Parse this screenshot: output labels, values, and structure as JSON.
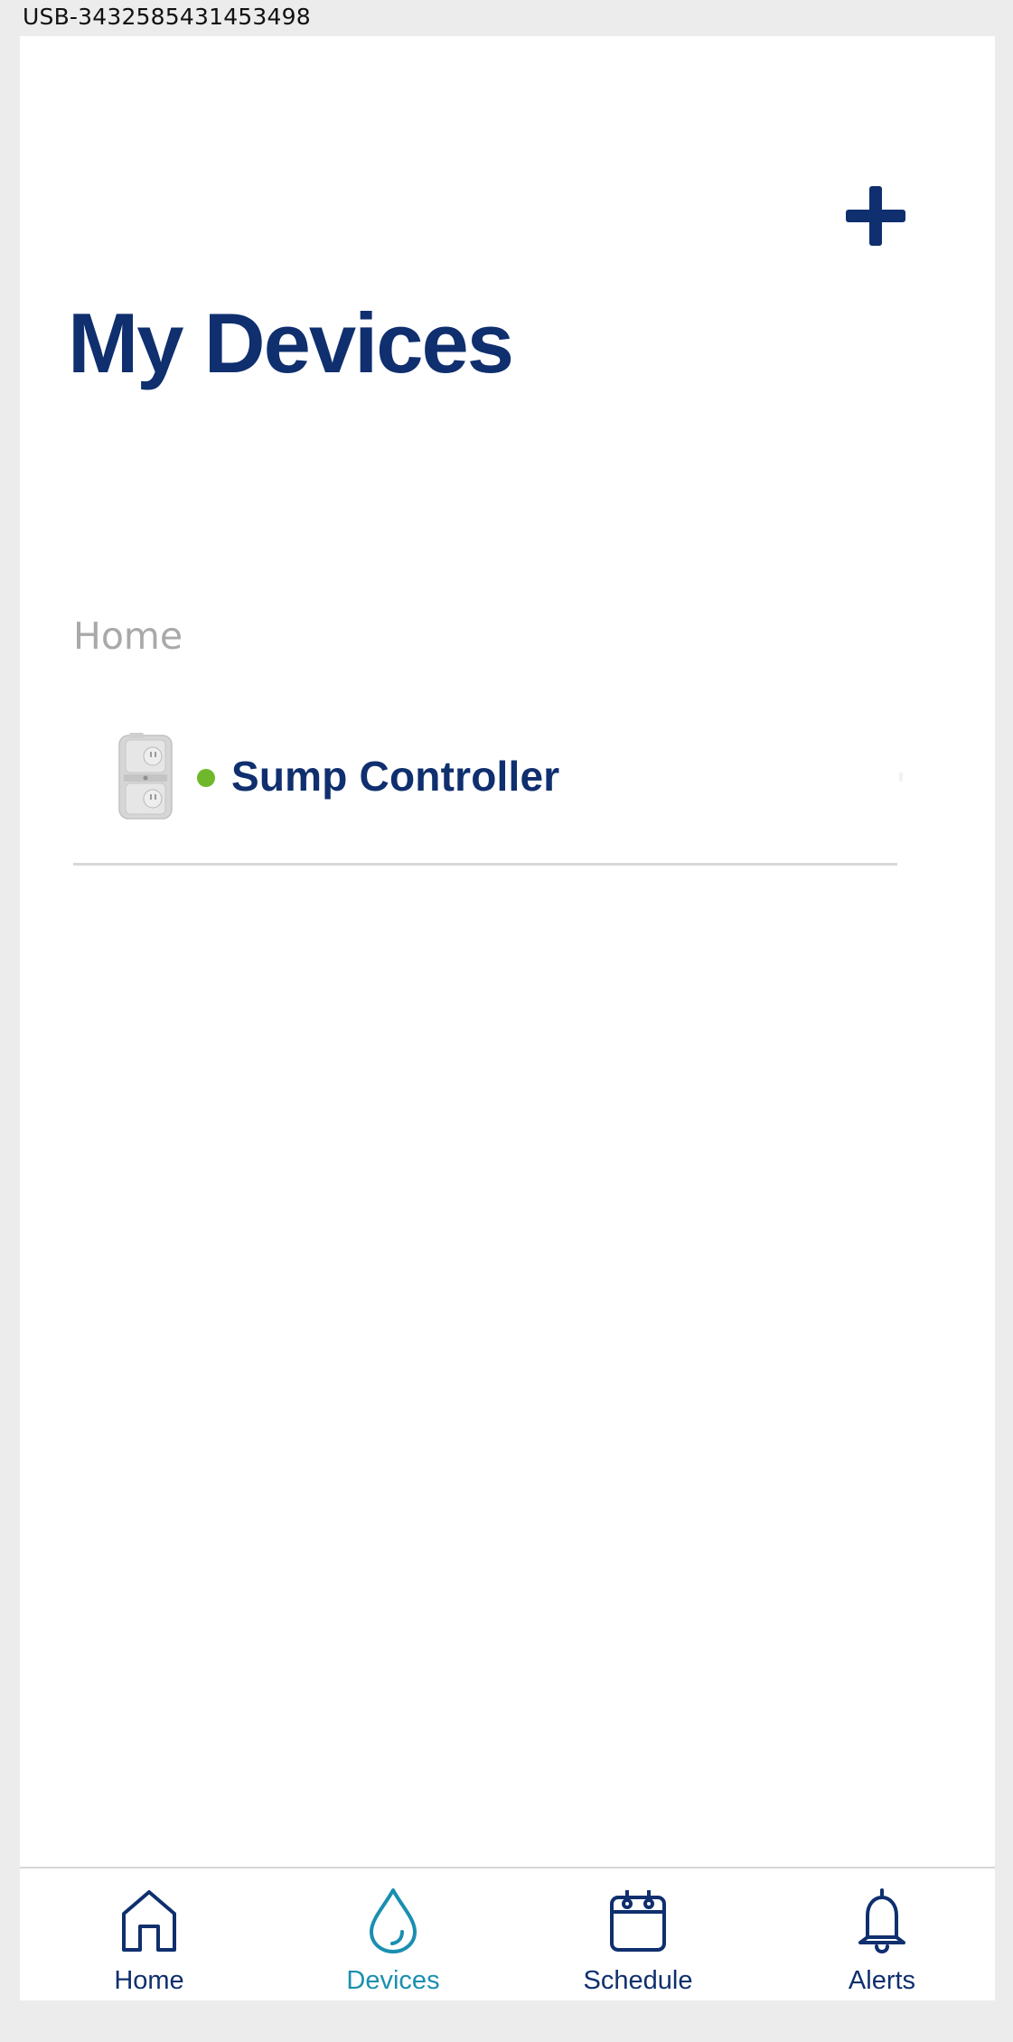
{
  "device_id": "USB-3432585431453498",
  "header": {
    "title": "My Devices",
    "add_icon": "plus-icon"
  },
  "section": {
    "label": "Home"
  },
  "devices": [
    {
      "name": "Sump Controller",
      "status": "online",
      "status_color": "#6fb82b",
      "image": "outlet-device-image"
    }
  ],
  "colors": {
    "brand": "#0f2f6e",
    "active_tab": "#1a8fb0",
    "section_label": "#a9a9a9"
  },
  "tabs": [
    {
      "label": "Home",
      "icon": "home-icon",
      "active": false
    },
    {
      "label": "Devices",
      "icon": "water-drop-icon",
      "active": true
    },
    {
      "label": "Schedule",
      "icon": "calendar-icon",
      "active": false
    },
    {
      "label": "Alerts",
      "icon": "bell-icon",
      "active": false
    }
  ]
}
